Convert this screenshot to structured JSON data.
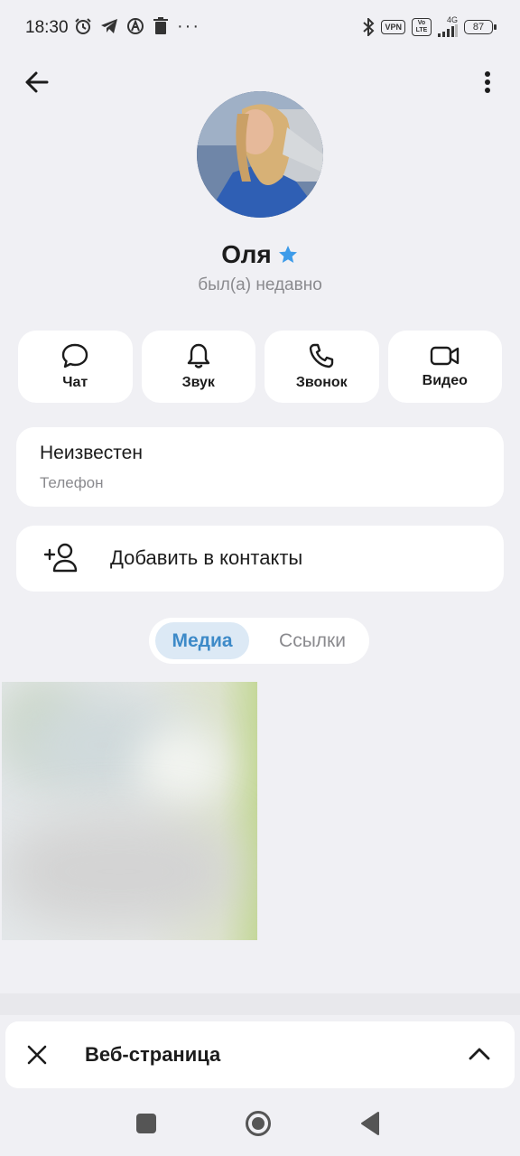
{
  "status_bar": {
    "time": "18:30",
    "dots": "···",
    "vpn": "VPN",
    "volte": "Vo LTE",
    "network": "4G",
    "battery": "87"
  },
  "profile": {
    "name": "Оля",
    "last_seen": "был(а) недавно"
  },
  "actions": [
    {
      "label": "Чат",
      "icon": "chat-bubble-icon"
    },
    {
      "label": "Звук",
      "icon": "bell-icon"
    },
    {
      "label": "Звонок",
      "icon": "phone-icon"
    },
    {
      "label": "Видео",
      "icon": "video-camera-icon"
    }
  ],
  "phone_card": {
    "value": "Неизвестен",
    "label": "Телефон"
  },
  "add_contact": {
    "label": "Добавить в контакты"
  },
  "tabs": {
    "active": "Медиа",
    "inactive": "Ссылки"
  },
  "web_page_bar": {
    "title": "Веб-страница"
  },
  "colors": {
    "accent": "#3d8ac8",
    "star": "#3d9be9",
    "background": "#f0f0f4"
  }
}
